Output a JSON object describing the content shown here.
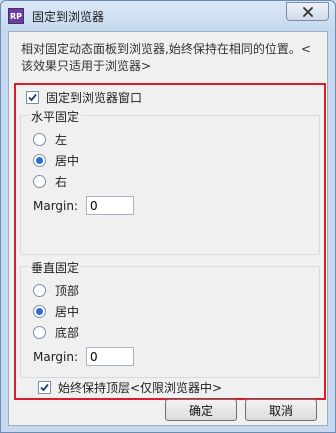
{
  "window": {
    "title": "固定到浏览器",
    "app_icon_text": "RP"
  },
  "description": {
    "line1": "相对固定动态面板到浏览器,始终保持在相同的位置。<",
    "line2": "该效果只适用于浏览器>"
  },
  "pin_to_browser": {
    "label": "固定到浏览器窗口",
    "checked": true
  },
  "horizontal": {
    "title": "水平固定",
    "options": [
      {
        "label": "左",
        "selected": false
      },
      {
        "label": "居中",
        "selected": true
      },
      {
        "label": "右",
        "selected": false
      }
    ],
    "margin_label": "Margin:",
    "margin_value": "0"
  },
  "vertical": {
    "title": "垂直固定",
    "options": [
      {
        "label": "顶部",
        "selected": false
      },
      {
        "label": "居中",
        "selected": true
      },
      {
        "label": "底部",
        "selected": false
      }
    ],
    "margin_label": "Margin:",
    "margin_value": "0"
  },
  "always_on_top": {
    "label": "始终保持顶层<仅限浏览器中>",
    "checked": true
  },
  "buttons": {
    "ok": "确定",
    "cancel": "取消"
  },
  "colors": {
    "highlight_frame": "#d71e2c",
    "radio_selected": "#2a6fce",
    "window_frame": "#c6d9ee"
  }
}
